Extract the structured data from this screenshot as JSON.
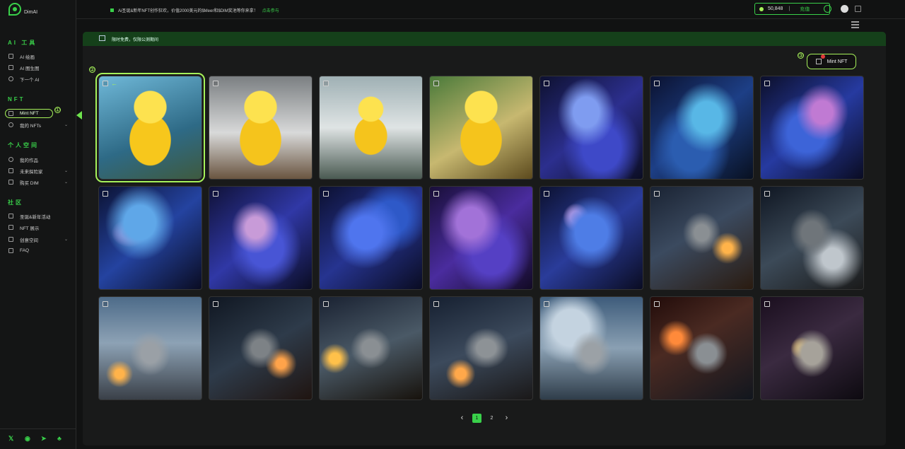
{
  "brand": {
    "name": "DimAI"
  },
  "sidebar": {
    "sections": [
      {
        "title": "AI 工具",
        "items": [
          {
            "label": "AI 绘画",
            "icon": "image-icon"
          },
          {
            "label": "AI 图生图",
            "icon": "image-edit-icon"
          },
          {
            "label": "下一个 AI",
            "icon": "info-icon"
          }
        ]
      },
      {
        "title": "NFT",
        "items": [
          {
            "label": "Mint NFT",
            "icon": "mint-icon",
            "active": true
          },
          {
            "label": "我的 NFTs",
            "icon": "nft-icon",
            "expandable": true
          }
        ]
      },
      {
        "title": "个人空间",
        "items": [
          {
            "label": "我的作品",
            "icon": "gear-icon"
          },
          {
            "label": "未来探险家",
            "icon": "explorer-icon",
            "expandable": true
          },
          {
            "label": "购买 DIM",
            "icon": "cart-icon",
            "expandable": true
          }
        ]
      },
      {
        "title": "社区",
        "items": [
          {
            "label": "圣诞&新年活动",
            "icon": "gift-icon"
          },
          {
            "label": "NFT 展示",
            "icon": "gallery-icon"
          },
          {
            "label": "创意空间",
            "icon": "space-icon",
            "expandable": true
          },
          {
            "label": "FAQ",
            "icon": "faq-icon"
          }
        ]
      }
    ],
    "step_badges": [
      "①",
      "②",
      "③"
    ]
  },
  "topbar": {
    "notice_text": "Ai圣诞&新年NFT创作狂欢，价值2000美元的$Meer和$DIM奖池等你来拿！",
    "notice_link": "点击参与",
    "balance": "50,848",
    "balance_separator": "|",
    "recharge_label": "充值"
  },
  "main": {
    "banner_text": "限时免费，仅限公测期间",
    "mint_button_label": "Mint NFT",
    "gallery": [
      {
        "style": "duck",
        "selected": true
      },
      {
        "style": "duck2"
      },
      {
        "style": "duck3"
      },
      {
        "style": "duck4"
      },
      {
        "style": "dragon1"
      },
      {
        "style": "dragon2"
      },
      {
        "style": "dragon3"
      },
      {
        "style": "dragon4"
      },
      {
        "style": "dragon5"
      },
      {
        "style": "dragon6"
      },
      {
        "style": "dragon7"
      },
      {
        "style": "dragon8"
      },
      {
        "style": "ship1"
      },
      {
        "style": "ship2"
      },
      {
        "style": "ship3"
      },
      {
        "style": "ship4"
      },
      {
        "style": "ship5"
      },
      {
        "style": "ship6"
      },
      {
        "style": "ship7"
      },
      {
        "style": "ship8"
      },
      {
        "style": "ship9"
      }
    ],
    "pagination": {
      "prev": "‹",
      "pages": [
        "1",
        "2"
      ],
      "current": "1",
      "next": "›"
    }
  },
  "colors": {
    "accent": "#39d04a",
    "highlight": "#a6f25a",
    "banner_bg": "#15401a"
  }
}
